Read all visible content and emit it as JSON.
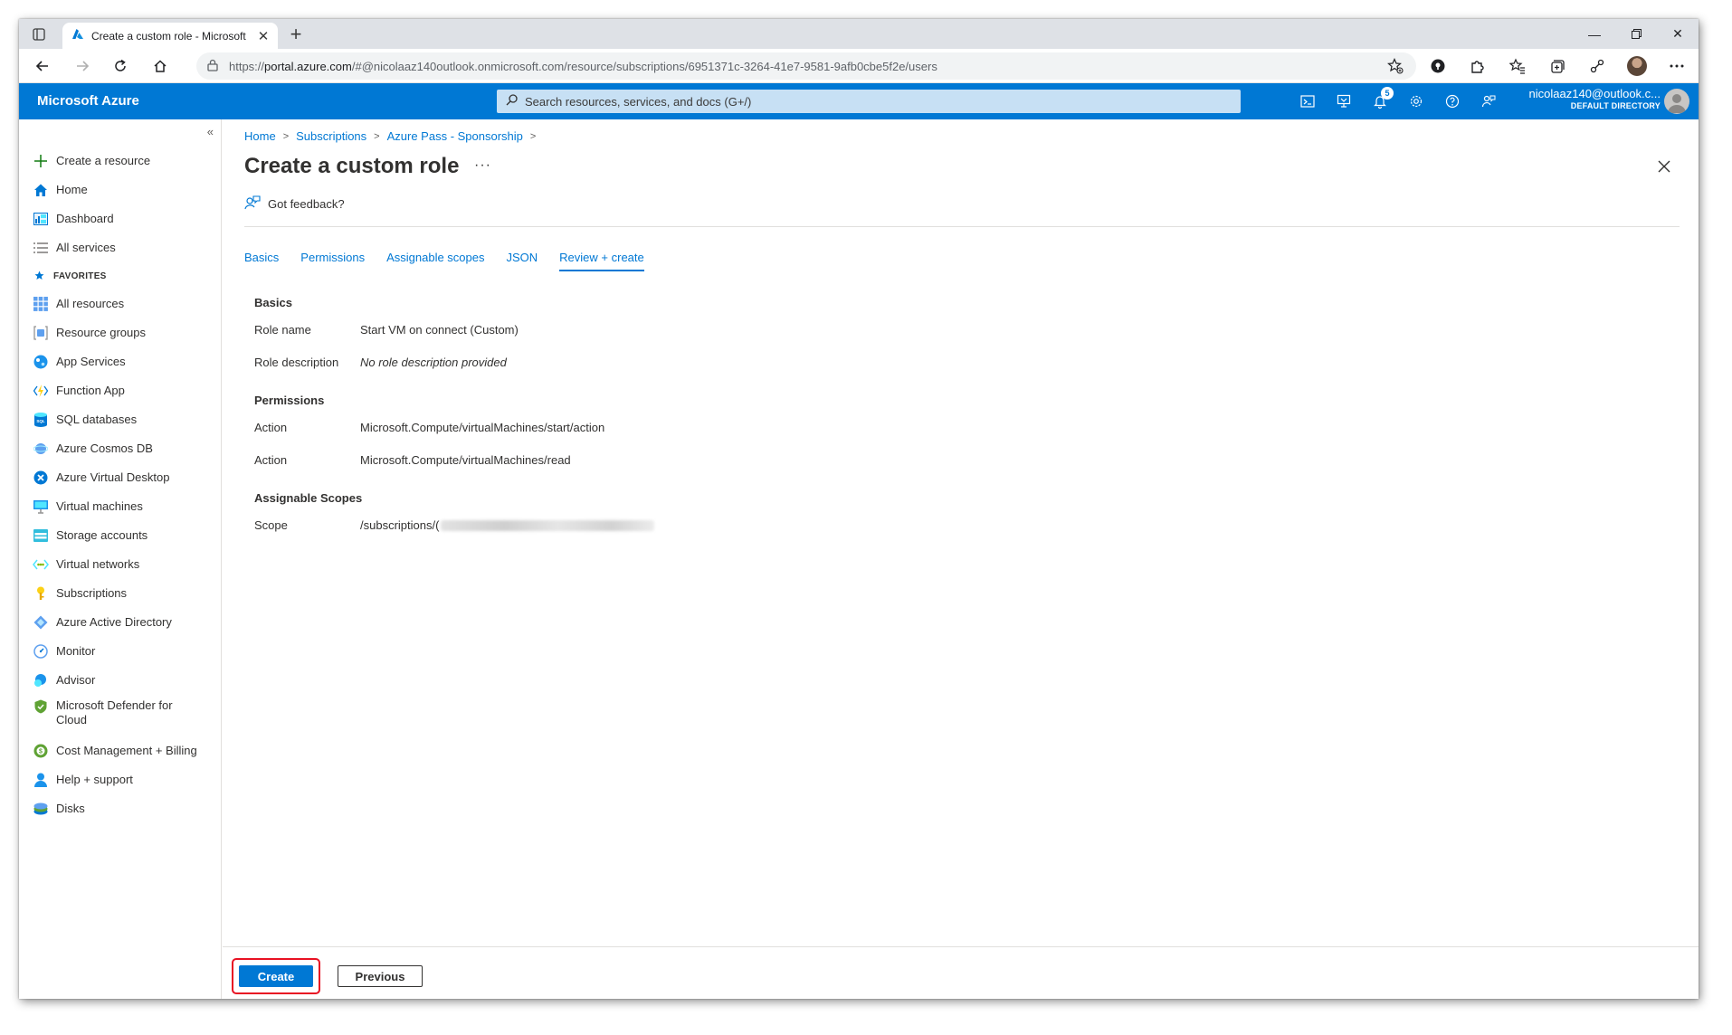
{
  "browser": {
    "tab_title": "Create a custom role - Microsoft",
    "url_prefix": "https://",
    "url_host": "portal.azure.com",
    "url_path": "/#@nicolaaz140outlook.onmicrosoft.com/resource/subscriptions/6951371c-3264-41e7-9581-9afb0cbe5f2e/users"
  },
  "header": {
    "brand": "Microsoft Azure",
    "search_placeholder": "Search resources, services, and docs (G+/)",
    "notification_count": "5",
    "account_email": "nicolaaz140@outlook.c...",
    "account_directory": "DEFAULT DIRECTORY"
  },
  "sidebar": {
    "items_top": [
      {
        "label": "Create a resource",
        "icon": "plus-icon"
      },
      {
        "label": "Home",
        "icon": "home-icon"
      },
      {
        "label": "Dashboard",
        "icon": "dashboard-icon"
      },
      {
        "label": "All services",
        "icon": "list-icon"
      }
    ],
    "favorites_label": "FAVORITES",
    "favorites": [
      {
        "label": "All resources",
        "icon": "grid-icon"
      },
      {
        "label": "Resource groups",
        "icon": "resource-group-icon"
      },
      {
        "label": "App Services",
        "icon": "globe-icon"
      },
      {
        "label": "Function App",
        "icon": "function-icon"
      },
      {
        "label": "SQL databases",
        "icon": "sql-icon"
      },
      {
        "label": "Azure Cosmos DB",
        "icon": "cosmos-icon"
      },
      {
        "label": "Azure Virtual Desktop",
        "icon": "virtual-desktop-icon"
      },
      {
        "label": "Virtual machines",
        "icon": "monitor-icon"
      },
      {
        "label": "Storage accounts",
        "icon": "storage-icon"
      },
      {
        "label": "Virtual networks",
        "icon": "network-icon"
      },
      {
        "label": "Subscriptions",
        "icon": "key-icon"
      },
      {
        "label": "Azure Active Directory",
        "icon": "diamond-icon"
      },
      {
        "label": "Monitor",
        "icon": "gauge-icon"
      },
      {
        "label": "Advisor",
        "icon": "advisor-icon"
      },
      {
        "label": "Microsoft Defender for Cloud",
        "icon": "shield-icon"
      },
      {
        "label": "Cost Management + Billing",
        "icon": "cost-icon"
      },
      {
        "label": "Help + support",
        "icon": "person-icon"
      },
      {
        "label": "Disks",
        "icon": "disk-icon"
      }
    ]
  },
  "breadcrumb": [
    "Home",
    "Subscriptions",
    "Azure Pass - Sponsorship"
  ],
  "page": {
    "title": "Create a custom role",
    "feedback_label": "Got feedback?"
  },
  "tabs": [
    {
      "label": "Basics",
      "active": false
    },
    {
      "label": "Permissions",
      "active": false
    },
    {
      "label": "Assignable scopes",
      "active": false
    },
    {
      "label": "JSON",
      "active": false
    },
    {
      "label": "Review + create",
      "active": true
    }
  ],
  "review": {
    "basics_title": "Basics",
    "role_name_label": "Role name",
    "role_name_value": "Start VM on connect (Custom)",
    "role_desc_label": "Role description",
    "role_desc_value": "No role description provided",
    "permissions_title": "Permissions",
    "permissions": [
      {
        "label": "Action",
        "value": "Microsoft.Compute/virtualMachines/start/action"
      },
      {
        "label": "Action",
        "value": "Microsoft.Compute/virtualMachines/read"
      }
    ],
    "scopes_title": "Assignable Scopes",
    "scope_label": "Scope",
    "scope_value": "/subscriptions/("
  },
  "footer": {
    "create_label": "Create",
    "previous_label": "Previous"
  },
  "colors": {
    "azure_blue": "#0078d4",
    "highlight_red": "#e81123"
  }
}
